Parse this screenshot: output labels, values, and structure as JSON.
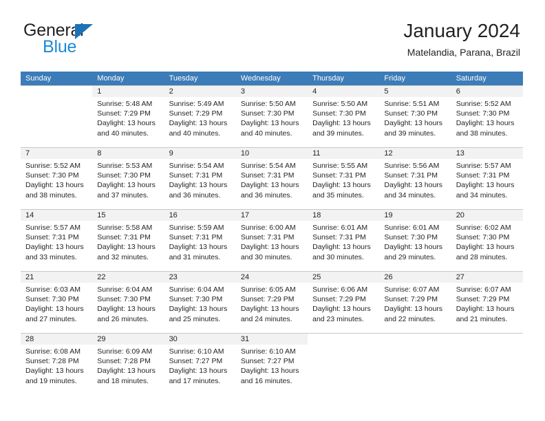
{
  "brand": {
    "logo_text_1": "General",
    "logo_text_2": "Blue",
    "logo_icon": "triangle-icon",
    "accent_color": "#1b8ad6",
    "header_color": "#3c7cb8"
  },
  "header": {
    "title": "January 2024",
    "subtitle": "Matelandia, Parana, Brazil"
  },
  "weekdays": [
    "Sunday",
    "Monday",
    "Tuesday",
    "Wednesday",
    "Thursday",
    "Friday",
    "Saturday"
  ],
  "labels": {
    "sunrise_prefix": "Sunrise:",
    "sunset_prefix": "Sunset:",
    "daylight_prefix": "Daylight:"
  },
  "weeks": [
    [
      {
        "day": "",
        "blank": true,
        "line1": "",
        "line2": "",
        "line3": "",
        "line4": ""
      },
      {
        "day": "1",
        "line1": "Sunrise: 5:48 AM",
        "line2": "Sunset: 7:29 PM",
        "line3": "Daylight: 13 hours",
        "line4": "and 40 minutes."
      },
      {
        "day": "2",
        "line1": "Sunrise: 5:49 AM",
        "line2": "Sunset: 7:29 PM",
        "line3": "Daylight: 13 hours",
        "line4": "and 40 minutes."
      },
      {
        "day": "3",
        "line1": "Sunrise: 5:50 AM",
        "line2": "Sunset: 7:30 PM",
        "line3": "Daylight: 13 hours",
        "line4": "and 40 minutes."
      },
      {
        "day": "4",
        "line1": "Sunrise: 5:50 AM",
        "line2": "Sunset: 7:30 PM",
        "line3": "Daylight: 13 hours",
        "line4": "and 39 minutes."
      },
      {
        "day": "5",
        "line1": "Sunrise: 5:51 AM",
        "line2": "Sunset: 7:30 PM",
        "line3": "Daylight: 13 hours",
        "line4": "and 39 minutes."
      },
      {
        "day": "6",
        "line1": "Sunrise: 5:52 AM",
        "line2": "Sunset: 7:30 PM",
        "line3": "Daylight: 13 hours",
        "line4": "and 38 minutes."
      }
    ],
    [
      {
        "day": "7",
        "line1": "Sunrise: 5:52 AM",
        "line2": "Sunset: 7:30 PM",
        "line3": "Daylight: 13 hours",
        "line4": "and 38 minutes."
      },
      {
        "day": "8",
        "line1": "Sunrise: 5:53 AM",
        "line2": "Sunset: 7:30 PM",
        "line3": "Daylight: 13 hours",
        "line4": "and 37 minutes."
      },
      {
        "day": "9",
        "line1": "Sunrise: 5:54 AM",
        "line2": "Sunset: 7:31 PM",
        "line3": "Daylight: 13 hours",
        "line4": "and 36 minutes."
      },
      {
        "day": "10",
        "line1": "Sunrise: 5:54 AM",
        "line2": "Sunset: 7:31 PM",
        "line3": "Daylight: 13 hours",
        "line4": "and 36 minutes."
      },
      {
        "day": "11",
        "line1": "Sunrise: 5:55 AM",
        "line2": "Sunset: 7:31 PM",
        "line3": "Daylight: 13 hours",
        "line4": "and 35 minutes."
      },
      {
        "day": "12",
        "line1": "Sunrise: 5:56 AM",
        "line2": "Sunset: 7:31 PM",
        "line3": "Daylight: 13 hours",
        "line4": "and 34 minutes."
      },
      {
        "day": "13",
        "line1": "Sunrise: 5:57 AM",
        "line2": "Sunset: 7:31 PM",
        "line3": "Daylight: 13 hours",
        "line4": "and 34 minutes."
      }
    ],
    [
      {
        "day": "14",
        "line1": "Sunrise: 5:57 AM",
        "line2": "Sunset: 7:31 PM",
        "line3": "Daylight: 13 hours",
        "line4": "and 33 minutes."
      },
      {
        "day": "15",
        "line1": "Sunrise: 5:58 AM",
        "line2": "Sunset: 7:31 PM",
        "line3": "Daylight: 13 hours",
        "line4": "and 32 minutes."
      },
      {
        "day": "16",
        "line1": "Sunrise: 5:59 AM",
        "line2": "Sunset: 7:31 PM",
        "line3": "Daylight: 13 hours",
        "line4": "and 31 minutes."
      },
      {
        "day": "17",
        "line1": "Sunrise: 6:00 AM",
        "line2": "Sunset: 7:31 PM",
        "line3": "Daylight: 13 hours",
        "line4": "and 30 minutes."
      },
      {
        "day": "18",
        "line1": "Sunrise: 6:01 AM",
        "line2": "Sunset: 7:31 PM",
        "line3": "Daylight: 13 hours",
        "line4": "and 30 minutes."
      },
      {
        "day": "19",
        "line1": "Sunrise: 6:01 AM",
        "line2": "Sunset: 7:30 PM",
        "line3": "Daylight: 13 hours",
        "line4": "and 29 minutes."
      },
      {
        "day": "20",
        "line1": "Sunrise: 6:02 AM",
        "line2": "Sunset: 7:30 PM",
        "line3": "Daylight: 13 hours",
        "line4": "and 28 minutes."
      }
    ],
    [
      {
        "day": "21",
        "line1": "Sunrise: 6:03 AM",
        "line2": "Sunset: 7:30 PM",
        "line3": "Daylight: 13 hours",
        "line4": "and 27 minutes."
      },
      {
        "day": "22",
        "line1": "Sunrise: 6:04 AM",
        "line2": "Sunset: 7:30 PM",
        "line3": "Daylight: 13 hours",
        "line4": "and 26 minutes."
      },
      {
        "day": "23",
        "line1": "Sunrise: 6:04 AM",
        "line2": "Sunset: 7:30 PM",
        "line3": "Daylight: 13 hours",
        "line4": "and 25 minutes."
      },
      {
        "day": "24",
        "line1": "Sunrise: 6:05 AM",
        "line2": "Sunset: 7:29 PM",
        "line3": "Daylight: 13 hours",
        "line4": "and 24 minutes."
      },
      {
        "day": "25",
        "line1": "Sunrise: 6:06 AM",
        "line2": "Sunset: 7:29 PM",
        "line3": "Daylight: 13 hours",
        "line4": "and 23 minutes."
      },
      {
        "day": "26",
        "line1": "Sunrise: 6:07 AM",
        "line2": "Sunset: 7:29 PM",
        "line3": "Daylight: 13 hours",
        "line4": "and 22 minutes."
      },
      {
        "day": "27",
        "line1": "Sunrise: 6:07 AM",
        "line2": "Sunset: 7:29 PM",
        "line3": "Daylight: 13 hours",
        "line4": "and 21 minutes."
      }
    ],
    [
      {
        "day": "28",
        "line1": "Sunrise: 6:08 AM",
        "line2": "Sunset: 7:28 PM",
        "line3": "Daylight: 13 hours",
        "line4": "and 19 minutes."
      },
      {
        "day": "29",
        "line1": "Sunrise: 6:09 AM",
        "line2": "Sunset: 7:28 PM",
        "line3": "Daylight: 13 hours",
        "line4": "and 18 minutes."
      },
      {
        "day": "30",
        "line1": "Sunrise: 6:10 AM",
        "line2": "Sunset: 7:27 PM",
        "line3": "Daylight: 13 hours",
        "line4": "and 17 minutes."
      },
      {
        "day": "31",
        "line1": "Sunrise: 6:10 AM",
        "line2": "Sunset: 7:27 PM",
        "line3": "Daylight: 13 hours",
        "line4": "and 16 minutes."
      },
      {
        "day": "",
        "blank": true,
        "line1": "",
        "line2": "",
        "line3": "",
        "line4": ""
      },
      {
        "day": "",
        "blank": true,
        "line1": "",
        "line2": "",
        "line3": "",
        "line4": ""
      },
      {
        "day": "",
        "blank": true,
        "line1": "",
        "line2": "",
        "line3": "",
        "line4": ""
      }
    ]
  ]
}
